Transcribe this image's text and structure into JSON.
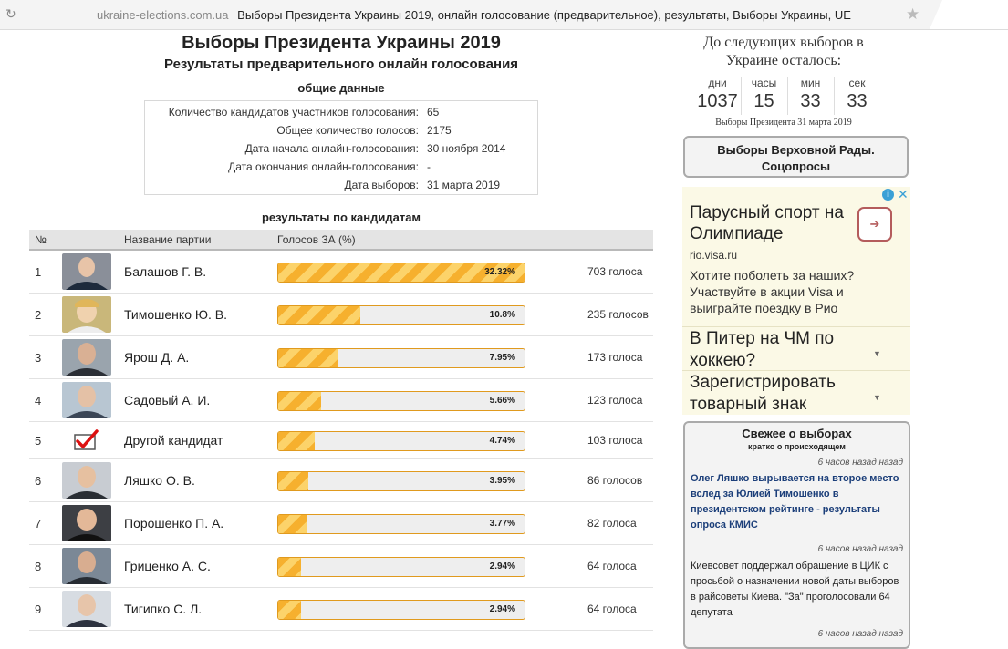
{
  "browser": {
    "reload_icon": "reload-icon",
    "domain": "ukraine-elections.com.ua",
    "page_title": "Выборы Президента Украины 2019, онлайн голосование (предварительное), результаты, Выборы Украины, UE",
    "star_icon": "star-icon"
  },
  "header": {
    "title": "Выборы Президента Украины 2019",
    "subtitle": "Результаты предварительного онлайн голосования",
    "general_heading": "общие данные"
  },
  "general_stats": [
    {
      "label": "Количество кандидатов участников голосования:",
      "value": "65"
    },
    {
      "label": "Общее количество голосов:",
      "value": "2175"
    },
    {
      "label": "Дата начала онлайн-голосования:",
      "value": "30 ноября 2014"
    },
    {
      "label": "Дата окончания онлайн-голосования:",
      "value": "-"
    },
    {
      "label": "Дата выборов:",
      "value": "31 марта 2019"
    }
  ],
  "results": {
    "heading": "результаты по кандидатам",
    "columns": {
      "num": "№",
      "name": "Название партии",
      "votes": "Голосов ЗА (%)"
    },
    "rows": [
      {
        "num": "1",
        "name": "Балашов Г. В.",
        "pct": "32.32%",
        "share": 0.3232,
        "votes": "703 голоса"
      },
      {
        "num": "2",
        "name": "Тимошенко Ю. В.",
        "pct": "10.8%",
        "share": 0.108,
        "votes": "235 голосов"
      },
      {
        "num": "3",
        "name": "Ярош Д. А.",
        "pct": "7.95%",
        "share": 0.0795,
        "votes": "173 голоса"
      },
      {
        "num": "4",
        "name": "Садовый А. И.",
        "pct": "5.66%",
        "share": 0.0566,
        "votes": "123 голоса"
      },
      {
        "num": "5",
        "name": "Другой кандидат",
        "pct": "4.74%",
        "share": 0.0474,
        "votes": "103 голоса"
      },
      {
        "num": "6",
        "name": "Ляшко О. В.",
        "pct": "3.95%",
        "share": 0.0395,
        "votes": "86 голосов"
      },
      {
        "num": "7",
        "name": "Порошенко П. А.",
        "pct": "3.77%",
        "share": 0.0377,
        "votes": "82 голоса"
      },
      {
        "num": "8",
        "name": "Гриценко А. С.",
        "pct": "2.94%",
        "share": 0.0294,
        "votes": "64 голоса"
      },
      {
        "num": "9",
        "name": "Тигипко С. Л.",
        "pct": "2.94%",
        "share": 0.0294,
        "votes": "64 голоса"
      }
    ]
  },
  "countdown": {
    "title": "До следующих выборов в Украине осталось:",
    "units": [
      {
        "label": "дни",
        "value": "1037"
      },
      {
        "label": "часы",
        "value": "15"
      },
      {
        "label": "мин",
        "value": "33"
      },
      {
        "label": "сек",
        "value": "33"
      }
    ],
    "election_date": "Выборы Президента 31 марта 2019"
  },
  "rada_button": {
    "line1": "Выборы Верховной Рады.",
    "line2": "Соцопросы"
  },
  "ad": {
    "info_icon": "info-icon",
    "close_icon": "close-icon",
    "headline": "Парусный спорт на Олимпиаде",
    "url": "rio.visa.ru",
    "body": "Хотите поболеть за наших? Участвуйте в акции Visa и выиграйте поездку в Рио",
    "links": [
      {
        "text": "В Питер на ЧМ по хоккею?"
      },
      {
        "text": "Зарегистрировать товарный знак"
      }
    ]
  },
  "news": {
    "title": "Свежее о выборах",
    "subtitle": "кратко о происходящем",
    "items": [
      {
        "time": "6 часов назад назад",
        "text": "Олег Ляшко вырывается на второе место вслед за Юлией Тимошенко в президентском рейтинге - результаты опроса КМИС"
      },
      {
        "time": "6 часов назад назад",
        "text": "Киевсовет поддержал обращение в ЦИК с просьбой о назначении новой даты выборов в райсоветы Киева. \"За\" проголосовали 64 депутата"
      },
      {
        "time": "6 часов назад назад"
      }
    ]
  },
  "colors": {
    "bar_orange": "#f6b02e",
    "bar_light": "#fcd36a",
    "bar_border": "#e09a1e",
    "news_link": "#1c3f7a",
    "ad_info": "#3aa0d6"
  }
}
